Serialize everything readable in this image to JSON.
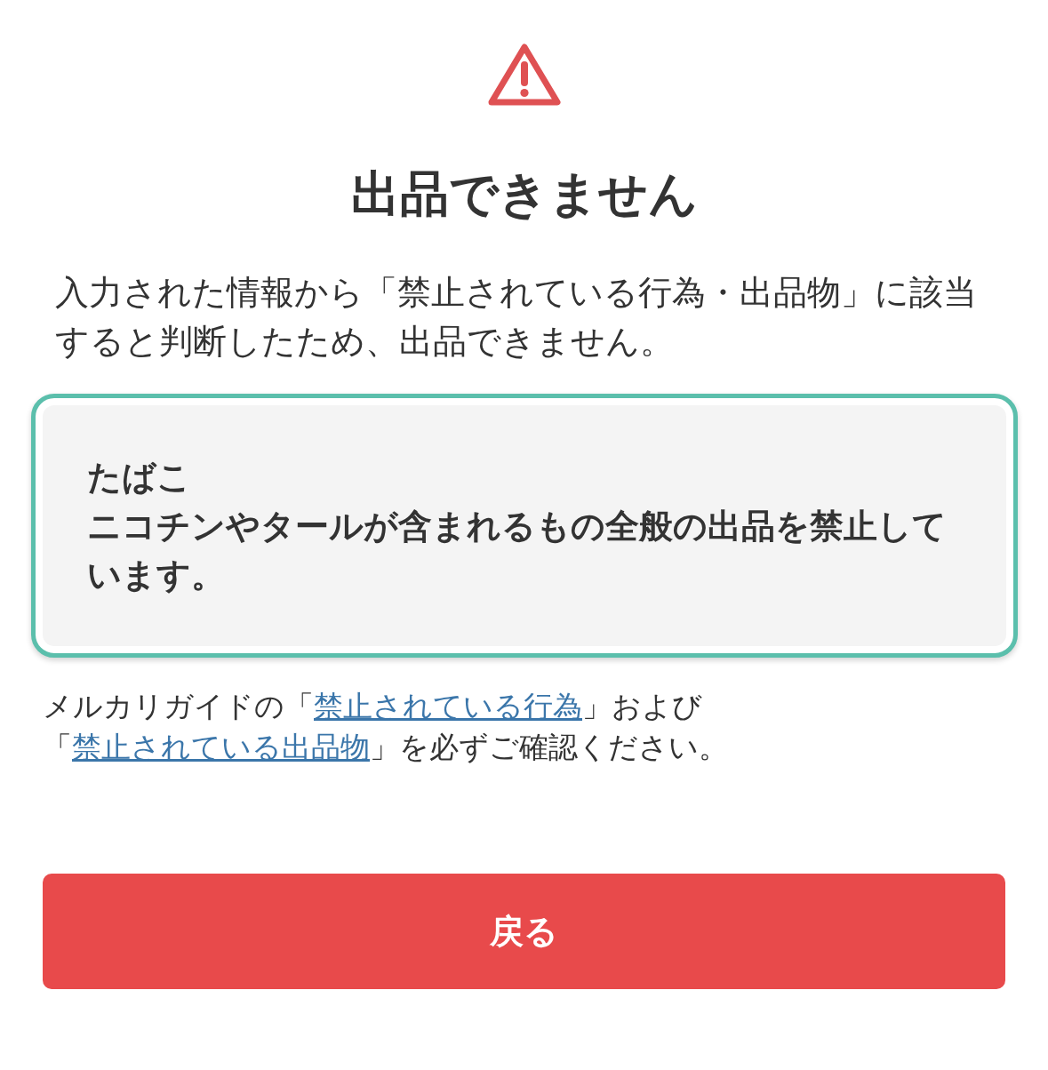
{
  "alert": {
    "title": "出品できません",
    "message": "入力された情報から「禁止されている行為・出品物」に該当すると判断したため、出品できません。"
  },
  "notice": {
    "title": "たばこ",
    "description": "ニコチンやタールが含まれるもの全般の出品を禁止しています。"
  },
  "guide": {
    "parts": [
      {
        "kind": "text",
        "text": "メルカリガイドの「"
      },
      {
        "kind": "link",
        "text": "禁止されている行為"
      },
      {
        "kind": "text",
        "text": "」および「"
      },
      {
        "kind": "link",
        "text": "禁止されている出品物"
      },
      {
        "kind": "text",
        "text": "」を必ずご確認ください。"
      }
    ]
  },
  "back_button": {
    "label": "戻る"
  }
}
